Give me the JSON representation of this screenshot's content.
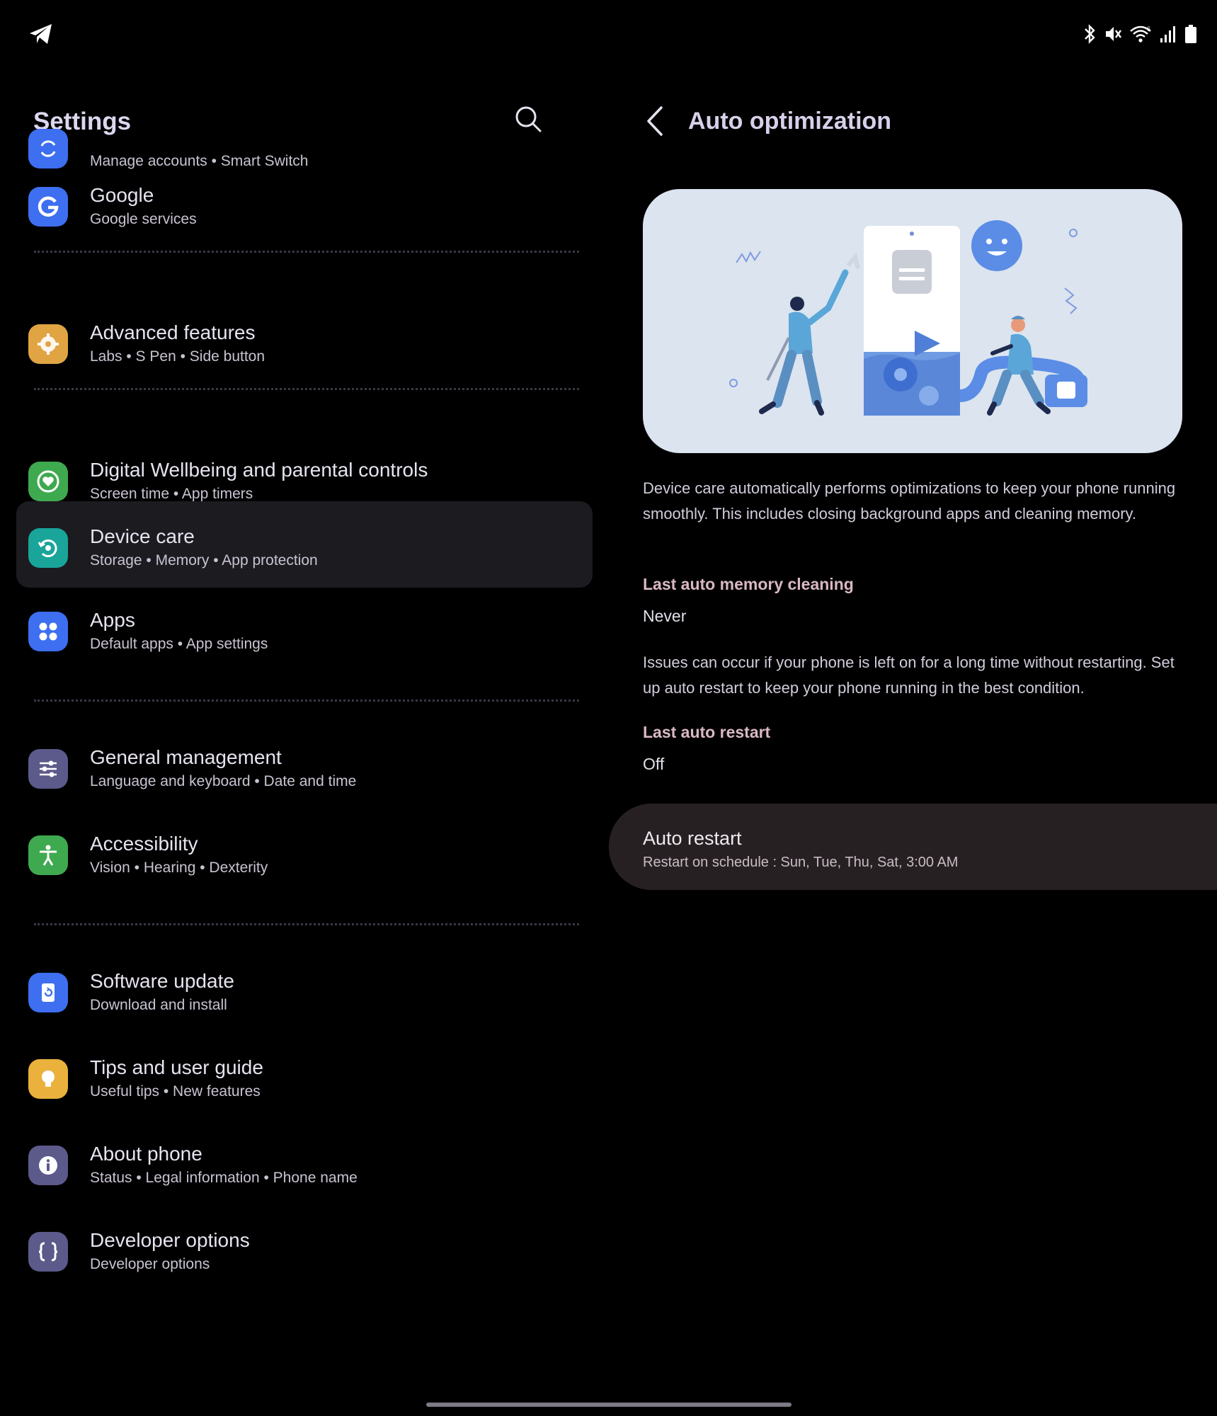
{
  "settings": {
    "title": "Settings",
    "search_icon": "search-icon",
    "items": [
      {
        "title": "",
        "subtitle": "Manage accounts • Smart Switch",
        "icon": "sync-icon",
        "color": "#3d6ff0"
      },
      {
        "title": "Google",
        "subtitle": "Google services",
        "icon": "google-icon",
        "color": "#3d6ff0"
      },
      {
        "title": "Advanced features",
        "subtitle": "Labs • S Pen • Side button",
        "icon": "gear-plus-icon",
        "color": "#e0a443"
      },
      {
        "title": "Digital Wellbeing and parental controls",
        "subtitle": "Screen time • App timers",
        "icon": "heart-circle-icon",
        "color": "#3fa94f"
      },
      {
        "title": "Device care",
        "subtitle": "Storage • Memory • App protection",
        "icon": "device-care-icon",
        "color": "#1aa59a"
      },
      {
        "title": "Apps",
        "subtitle": "Default apps • App settings",
        "icon": "apps-grid-icon",
        "color": "#3d6ff0"
      },
      {
        "title": "General management",
        "subtitle": "Language and keyboard • Date and time",
        "icon": "sliders-icon",
        "color": "#5b5a8a"
      },
      {
        "title": "Accessibility",
        "subtitle": "Vision • Hearing • Dexterity",
        "icon": "accessibility-icon",
        "color": "#3fa94f"
      },
      {
        "title": "Software update",
        "subtitle": "Download and install",
        "icon": "update-icon",
        "color": "#3d6ff0"
      },
      {
        "title": "Tips and user guide",
        "subtitle": "Useful tips • New features",
        "icon": "bulb-icon",
        "color": "#eab13d"
      },
      {
        "title": "About phone",
        "subtitle": "Status • Legal information • Phone name",
        "icon": "info-icon",
        "color": "#5b5a8a"
      },
      {
        "title": "Developer options",
        "subtitle": "Developer options",
        "icon": "braces-icon",
        "color": "#5b5a8a"
      }
    ],
    "selected": "Device care"
  },
  "detail": {
    "title": "Auto optimization",
    "back_icon": "back-arrow-icon",
    "description": "Device care automatically performs optimizations to keep your phone running smoothly. This includes closing background apps and cleaning memory.",
    "last_memory_label": "Last auto memory cleaning",
    "last_memory_value": "Never",
    "issues_text": "Issues can occur if your phone is left on for a long time without restarting. Set up auto restart to keep your phone running in the best condition.",
    "last_restart_label": "Last auto restart",
    "last_restart_value": "Off",
    "auto_restart": {
      "title": "Auto restart",
      "subtitle": "Restart on schedule : Sun, Tue, Thu, Sat, 3:00 AM"
    }
  },
  "status_bar": {
    "icons": [
      "telegram-icon",
      "bluetooth-icon",
      "mute-icon",
      "wifi-icon",
      "signal-icon",
      "battery-icon"
    ]
  },
  "colors": {
    "background": "#000000",
    "selected_row": "#1c1b20",
    "accent_heading": "#d9b8c4",
    "auto_card": "#272023",
    "illustration_bg": "#dbe4ef"
  }
}
